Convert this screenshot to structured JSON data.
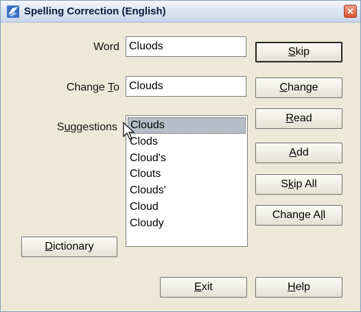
{
  "window": {
    "title": "Spelling Correction (English)",
    "close_icon": "close-icon"
  },
  "fields": {
    "word_label_pre": "Word",
    "word_value": "Cluods",
    "change_to_label_pre": "Change ",
    "change_to_label_key": "T",
    "change_to_label_post": "o",
    "change_to_value": "Clouds",
    "suggestions_label_pre": "S",
    "suggestions_label_key": "u",
    "suggestions_label_post": "ggestions"
  },
  "suggestions": {
    "selected": "Clouds",
    "items": [
      "Clouds",
      "Clods",
      "Cloud's",
      "Clouts",
      "Clouds'",
      "Cloud",
      "Cloudy"
    ]
  },
  "buttons": {
    "skip": {
      "key": "S",
      "rest": "kip"
    },
    "change": {
      "key": "C",
      "rest": "hange"
    },
    "read": {
      "key": "R",
      "rest": "ead"
    },
    "add": {
      "key": "A",
      "rest": "dd"
    },
    "skip_all": {
      "pre": "S",
      "key": "k",
      "rest": "ip All"
    },
    "change_all": {
      "pre": "Change A",
      "key": "l",
      "rest": "l"
    },
    "dictionary": {
      "key": "D",
      "rest": "ictionary"
    },
    "exit": {
      "key": "E",
      "rest": "xit"
    },
    "help": {
      "key": "H",
      "rest": "elp"
    }
  }
}
